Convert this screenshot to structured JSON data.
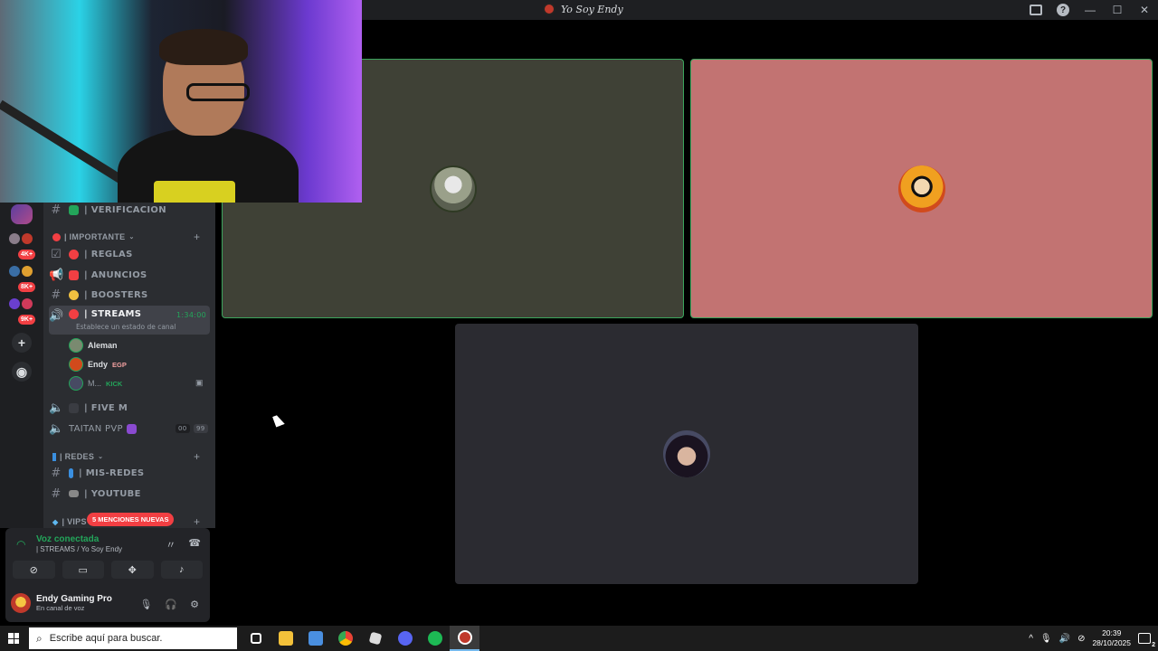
{
  "window": {
    "title": "Yo Soy Endy"
  },
  "server_rail": {
    "badges": [
      "4K+",
      "8K+",
      "9K+"
    ]
  },
  "channels": {
    "top_channel": "| VERIFICACION",
    "categories": [
      {
        "label": "| IMPORTANTE"
      },
      {
        "label": "| REDES"
      },
      {
        "label": "| VIPS"
      }
    ],
    "items": [
      {
        "label": "| REGLAS"
      },
      {
        "label": "| ANUNCIOS"
      },
      {
        "label": "| BOOSTERS"
      }
    ],
    "active_voice": {
      "label": "| STREAMS",
      "subtitle": "Establece un estado de canal",
      "time": "1:34:00"
    },
    "voice_users": [
      {
        "name": "Aleman",
        "tag": ""
      },
      {
        "name": "Endy",
        "tag": "EGP"
      },
      {
        "name": "M...",
        "tag": "KICK"
      }
    ],
    "more_voice": [
      {
        "label": "| FIVE M"
      },
      {
        "label": "TAITAN PVP"
      }
    ],
    "taitan_counts": [
      "00",
      "99"
    ],
    "redes_items": [
      {
        "label": "| MIS-REDES"
      },
      {
        "label": "| YOUTUBE"
      }
    ],
    "mention_pill": "5 MENCIONES NUEVAS"
  },
  "voice_panel": {
    "status": "Voz conectada",
    "location": "| STREAMS / Yo Soy Endy"
  },
  "user_panel": {
    "name": "Endy Gaming Pro",
    "status": "En canal de voz"
  },
  "taskbar": {
    "search_placeholder": "Escribe aquí para buscar.",
    "time": "20:39",
    "date": "28/10/2025",
    "notif_count": "2"
  },
  "colors": {
    "accent_green": "#23a55a",
    "tile1_bg": "#3f4136",
    "tile2_bg": "#c27372",
    "tile3_bg": "#2b2b31",
    "mention_red": "#f23f43"
  },
  "icons": {
    "tile_avatars": [
      "avatar-1",
      "avatar-2",
      "avatar-3"
    ]
  }
}
